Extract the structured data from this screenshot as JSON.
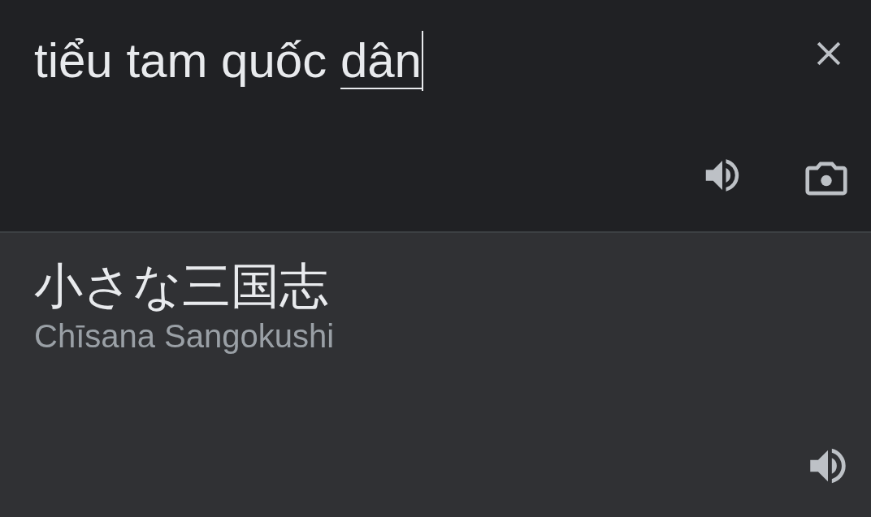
{
  "source": {
    "text": "tiểu tam quốc ",
    "composing": "dân"
  },
  "translation": {
    "text": "小さな三国志",
    "romanization": "Chīsana Sangokushi"
  }
}
